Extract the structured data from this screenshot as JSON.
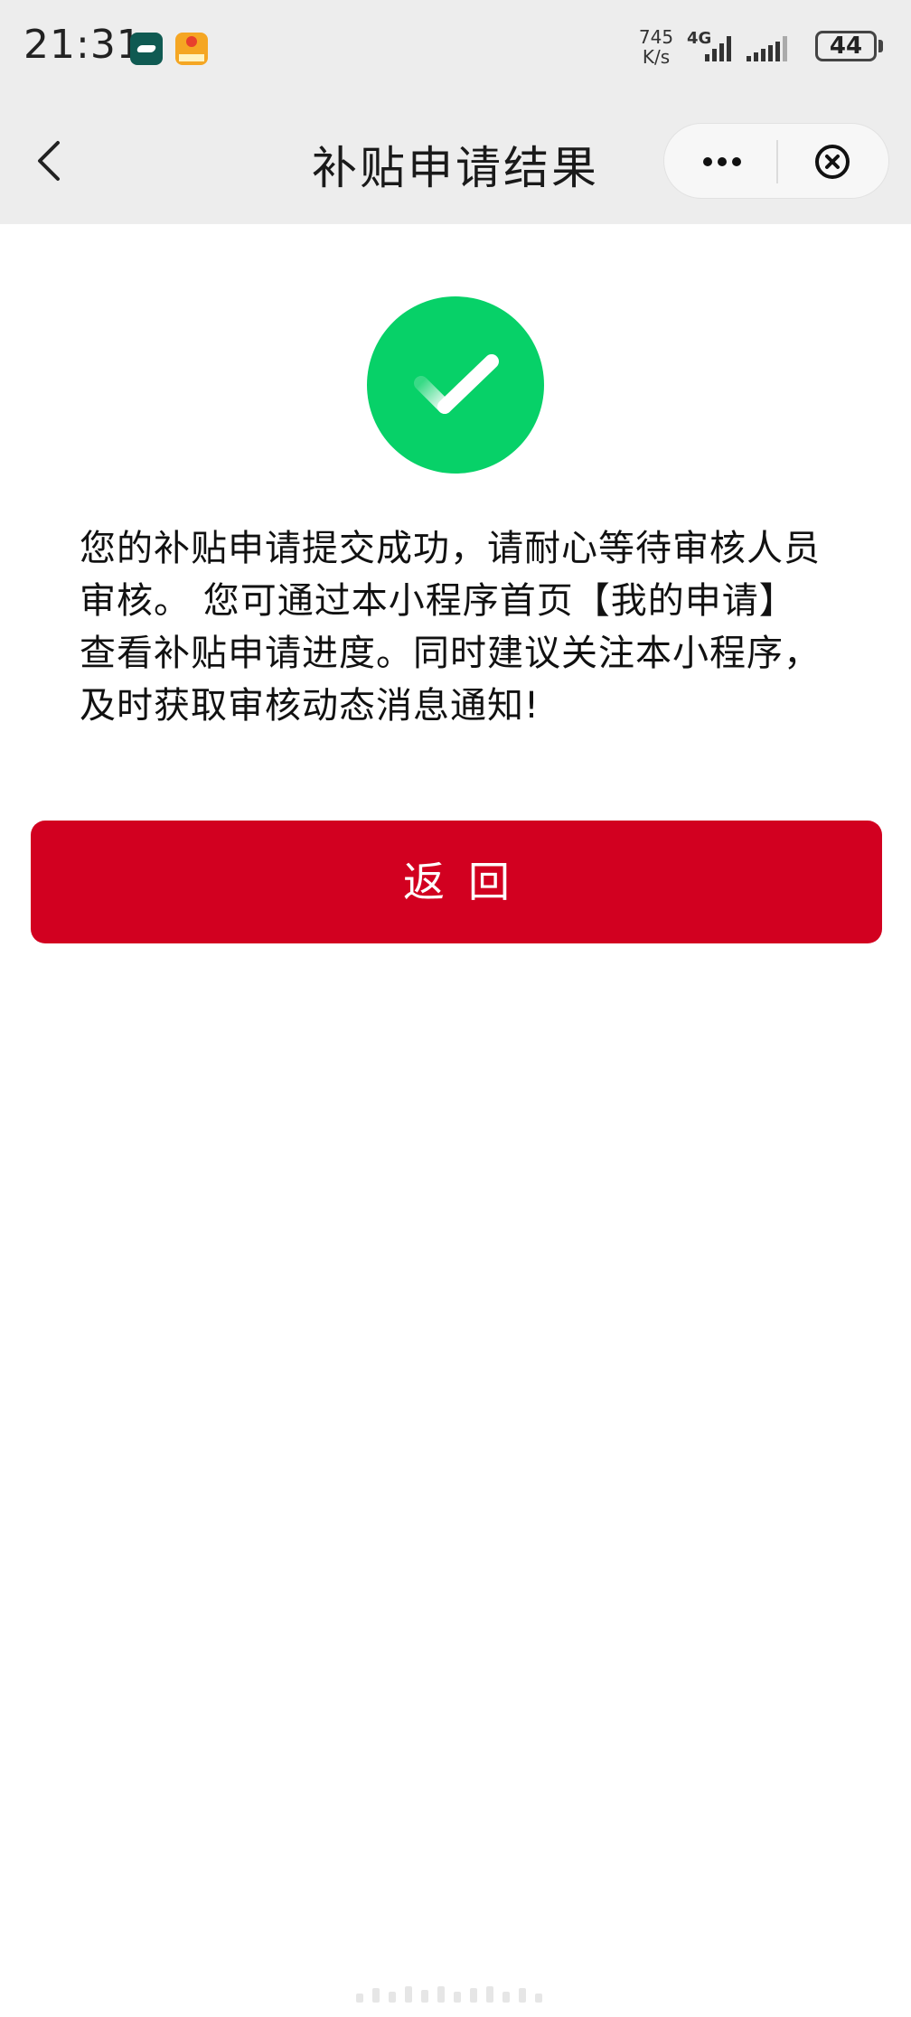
{
  "status_bar": {
    "time": "21:31",
    "net_speed_value": "745",
    "net_speed_unit": "K/s",
    "network_type": "4G",
    "battery": "44",
    "app_icons": [
      "app-notification-icon",
      "app-notification-icon"
    ]
  },
  "nav": {
    "title": "补贴申请结果",
    "back_icon": "chevron-left-icon",
    "more_icon": "more-dots-icon",
    "close_icon": "close-circle-icon"
  },
  "result": {
    "status_icon": "check-circle-icon",
    "status_color": "#07c160",
    "message": "您的补贴申请提交成功，请耐心等待审核人员审核。 您可通过本小程序首页【我的申请】查看补贴申请进度。同时建议关注本小程序，及时获取审核动态消息通知!"
  },
  "actions": {
    "return_label": "返回",
    "return_color": "#d20020"
  }
}
